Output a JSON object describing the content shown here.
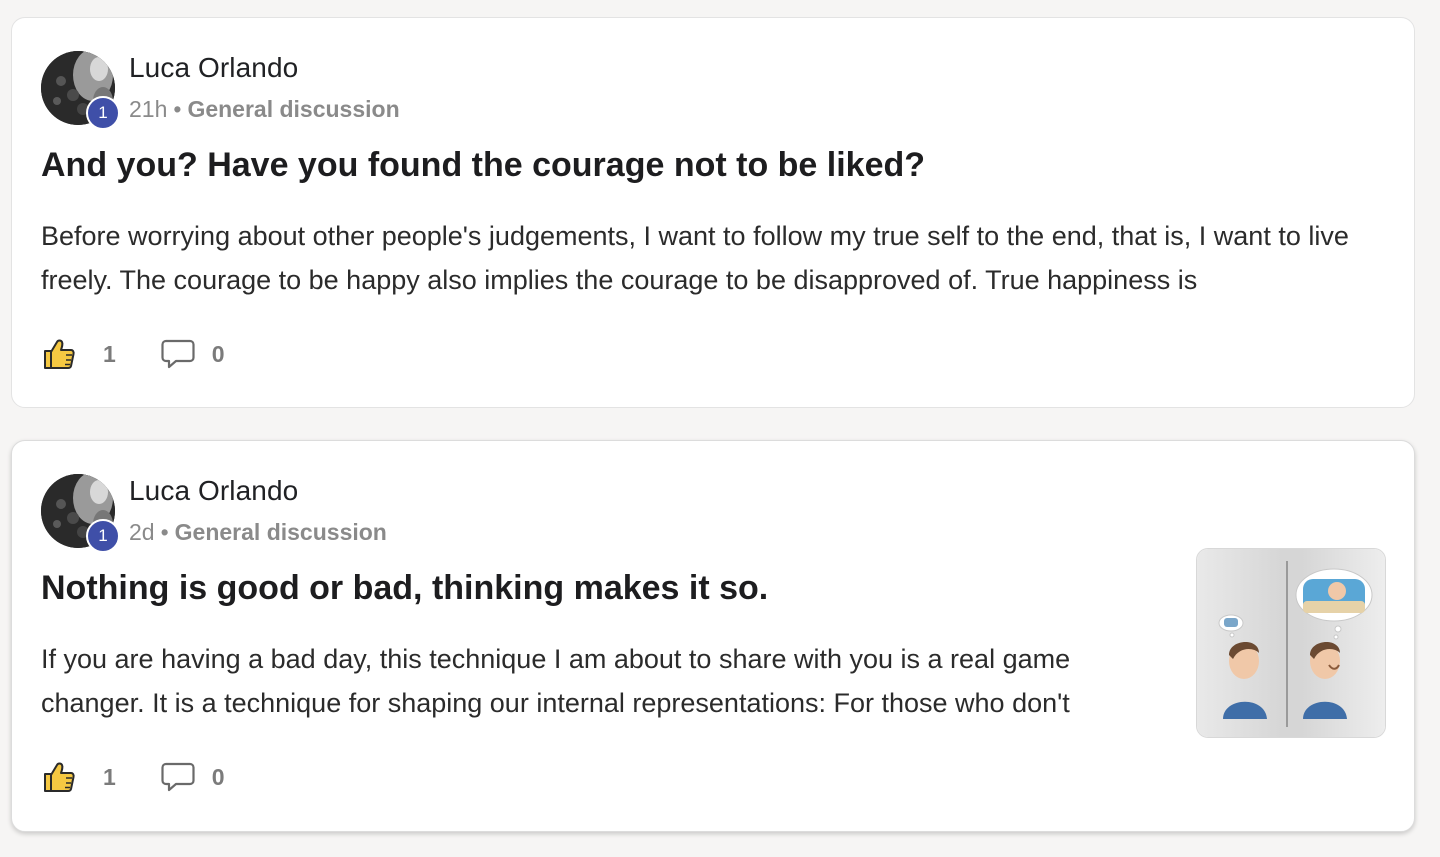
{
  "posts": [
    {
      "author": "Luca Orlando",
      "level": "1",
      "time": "21h",
      "separator": "•",
      "category": "General discussion",
      "title": "And you? Have you found the courage not to be liked?",
      "body": "Before worrying about other people's judgements, I want to follow my true self to the end, that is, I want to live freely. The courage to be happy also implies the courage to be disapproved of. True happiness is",
      "likes": "1",
      "comments": "0",
      "has_thumbnail": false
    },
    {
      "author": "Luca Orlando",
      "level": "1",
      "time": "2d",
      "separator": "•",
      "category": "General discussion",
      "title": "Nothing is good or bad, thinking makes it so.",
      "body": "If you are having a bad day, this technique I am about to share with you is a real game changer. It is a technique for shaping our internal representations: For those who don't",
      "likes": "1",
      "comments": "0",
      "has_thumbnail": true
    }
  ],
  "icons": {
    "like": "thumbs-up-icon",
    "comment": "comment-bubble-icon"
  },
  "colors": {
    "background": "#f6f5f4",
    "card": "#ffffff",
    "level_badge": "#3f4fa8",
    "like_icon": "#f5c842",
    "muted_text": "#8a8a8a"
  }
}
